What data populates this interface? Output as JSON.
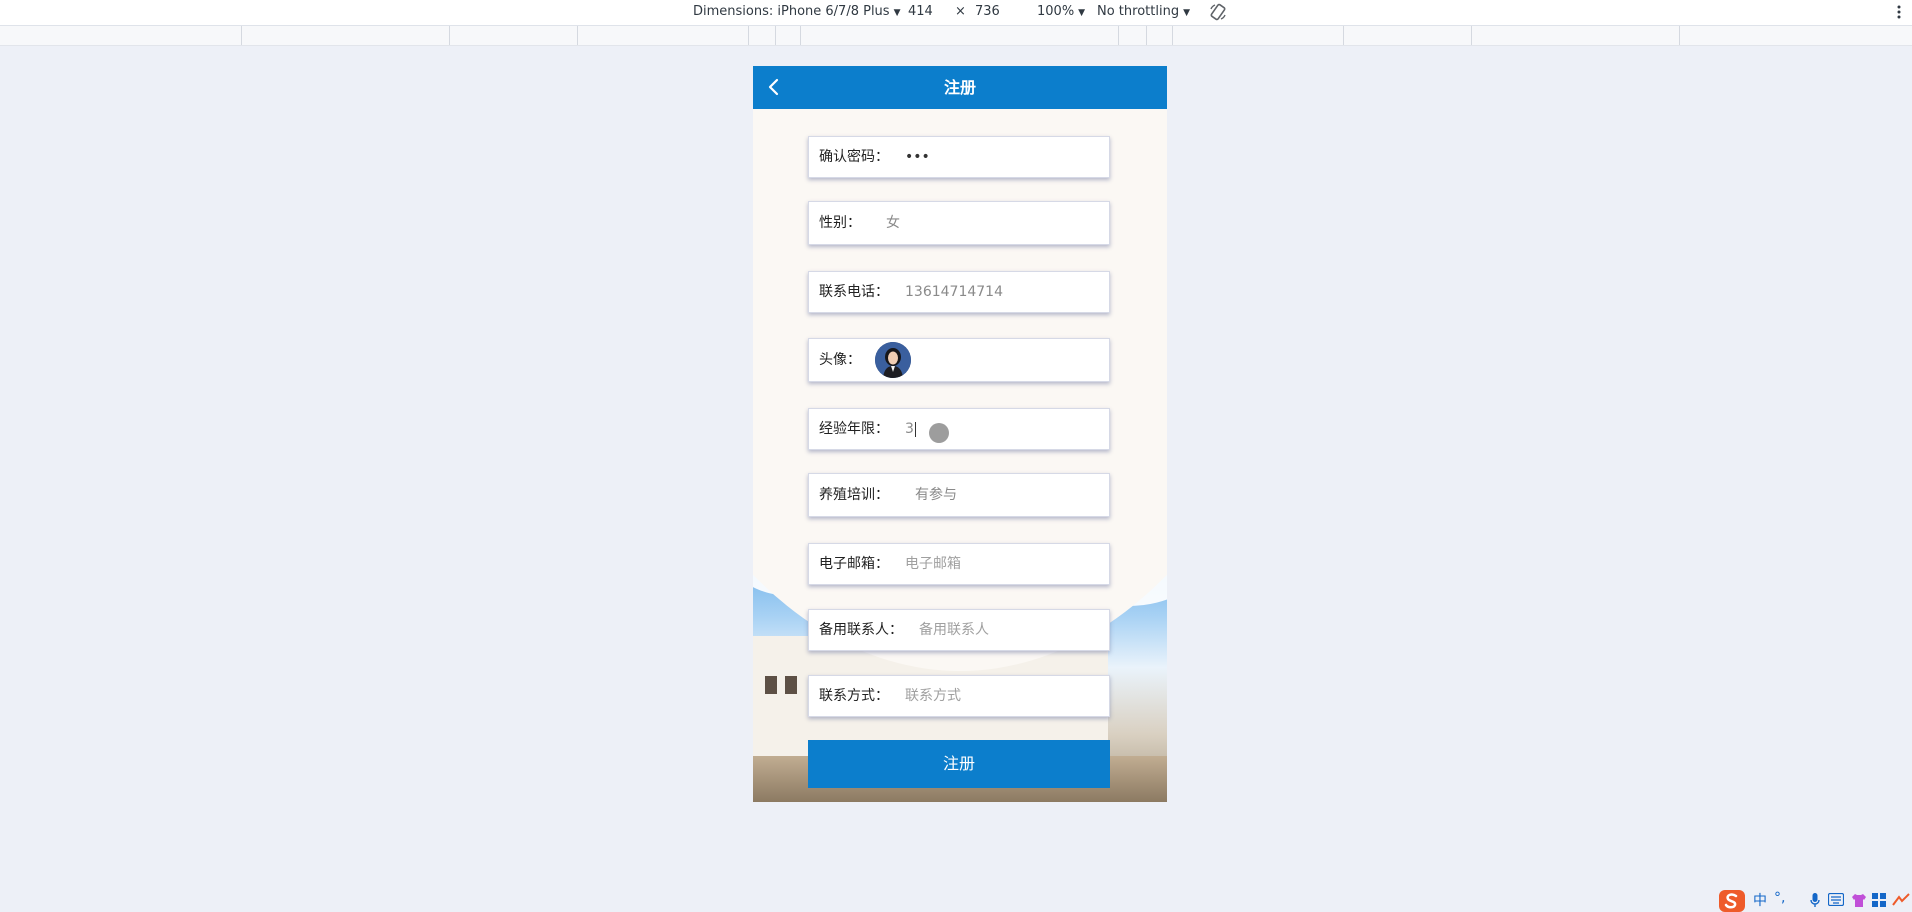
{
  "devtools": {
    "device_label": "Dimensions: iPhone 6/7/8 Plus",
    "width": "414",
    "times": "×",
    "height": "736",
    "zoom": "100%",
    "throttling": "No throttling",
    "caret": "▼"
  },
  "app": {
    "title": "注册",
    "fields": [
      {
        "label": "确认密码：",
        "value": "•••"
      },
      {
        "label": "性别：",
        "value": "女"
      },
      {
        "label": "联系电话：",
        "value": "13614714714"
      },
      {
        "label": "头像："
      },
      {
        "label": "经验年限：",
        "value": "3"
      },
      {
        "label": "养殖培训：",
        "value": "有参与"
      },
      {
        "label": "电子邮箱：",
        "placeholder": "电子邮箱"
      },
      {
        "label": "备用联系人：",
        "placeholder": "备用联系人"
      },
      {
        "label": "联系方式：",
        "placeholder": "联系方式"
      }
    ],
    "submit_label": "注册"
  },
  "tray": {
    "ime_lang": "中",
    "ime_punct": "°,"
  },
  "colors": {
    "primary": "#0c7ecc",
    "page_bg": "#edf0f7"
  }
}
